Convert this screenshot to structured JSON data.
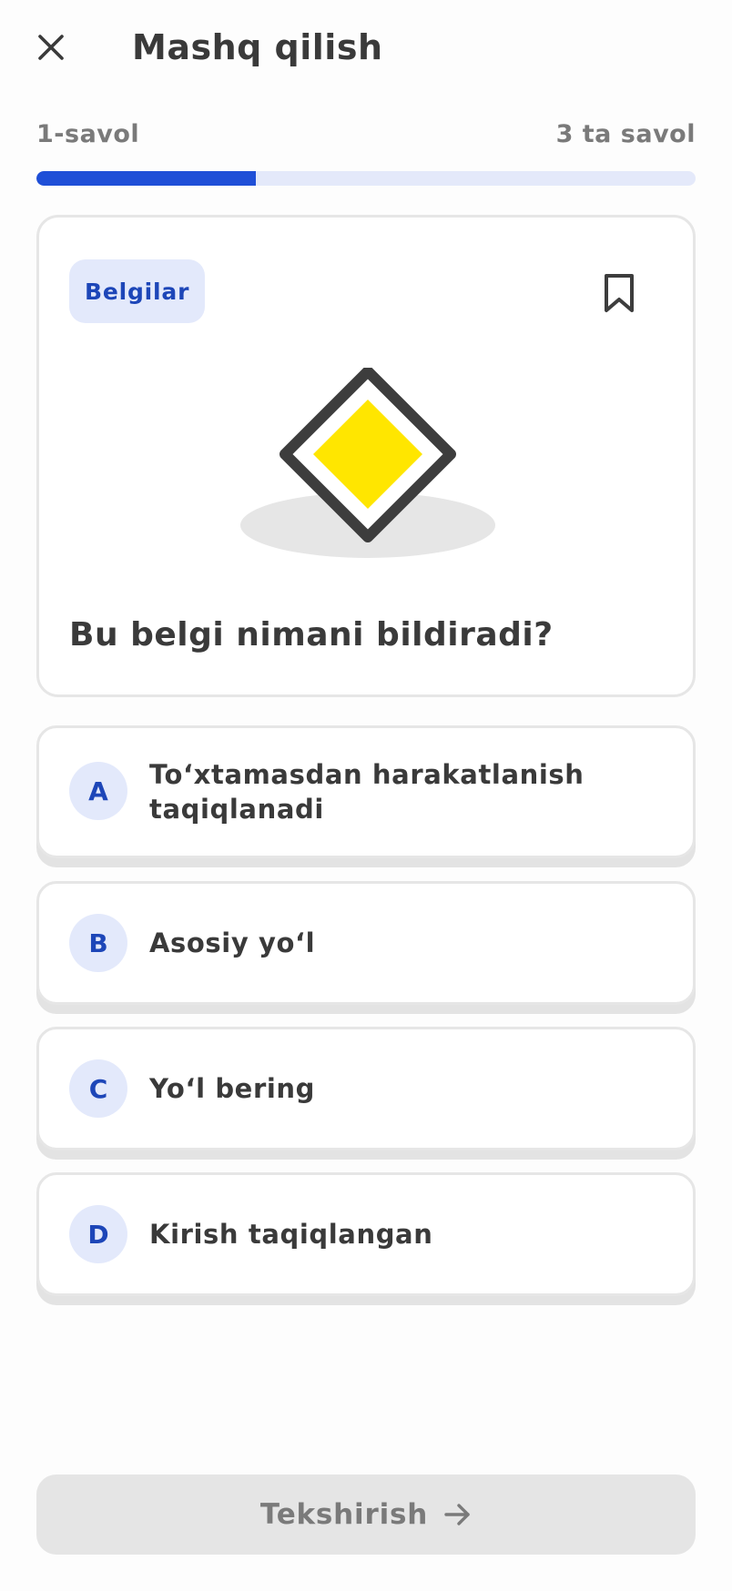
{
  "header": {
    "title": "Mashq qilish",
    "close_icon": "close-icon"
  },
  "progress": {
    "current_label": "1-savol",
    "total_label": "3 ta savol",
    "current": 1,
    "total": 3,
    "fraction": 0.333
  },
  "question": {
    "category": "Belgilar",
    "bookmark_icon": "bookmark-icon",
    "image": "main-road-sign-icon",
    "text": "Bu belgi nimani bildiradi?"
  },
  "options": [
    {
      "letter": "A",
      "text": "To‘xtamasdan harakatlanish taqiqlanadi"
    },
    {
      "letter": "B",
      "text": "Asosiy yo‘l"
    },
    {
      "letter": "C",
      "text": "Yo‘l bering"
    },
    {
      "letter": "D",
      "text": "Kirish taqiqlangan"
    }
  ],
  "footer": {
    "check_label": "Tekshirish",
    "check_icon": "arrow-right-icon",
    "check_enabled": false
  },
  "colors": {
    "accent": "#1f4fd7",
    "accent_light": "#e3e9fb",
    "sign_yellow": "#ffe600",
    "sign_border": "#3d3d3d",
    "disabled": "#e5e5e5"
  }
}
